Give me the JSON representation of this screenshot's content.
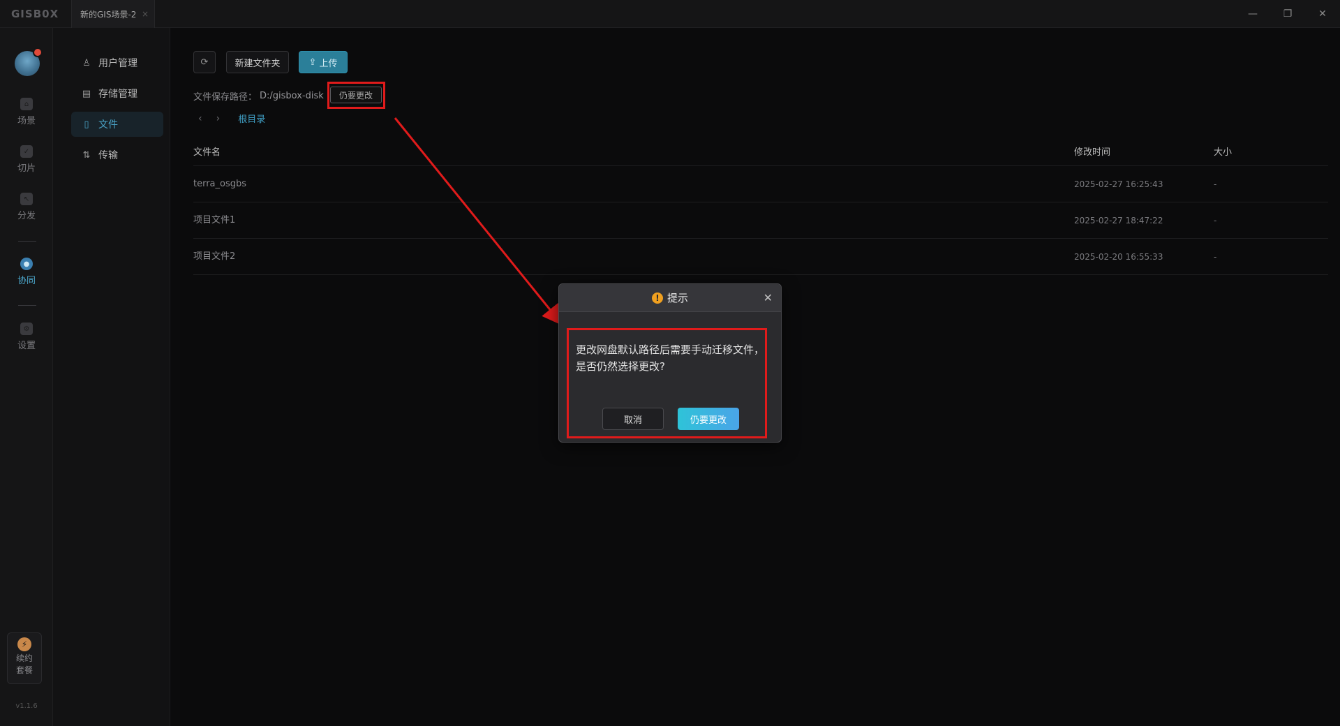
{
  "titlebar": {
    "logo": "GISB0X",
    "tab_label": "新的GIS场景-2",
    "tab_close": "×",
    "minimize": "—",
    "restore": "❐",
    "close": "✕"
  },
  "rail": {
    "items": [
      {
        "label": "场景",
        "icon": "scene-icon"
      },
      {
        "label": "切片",
        "icon": "tile-icon"
      },
      {
        "label": "分发",
        "icon": "distribute-icon"
      },
      {
        "label": "协同",
        "icon": "collab-icon",
        "active": true
      },
      {
        "label": "设置",
        "icon": "settings-icon"
      }
    ],
    "plan_line1": "续约",
    "plan_line2": "套餐",
    "version": "v1.1.6"
  },
  "submenu": {
    "items": [
      {
        "label": "用户管理",
        "icon": "user-icon"
      },
      {
        "label": "存储管理",
        "icon": "storage-icon"
      },
      {
        "label": "文件",
        "icon": "file-icon",
        "active": true
      },
      {
        "label": "传输",
        "icon": "transfer-icon"
      }
    ]
  },
  "toolbar": {
    "new_folder": "新建文件夹",
    "upload": "上传"
  },
  "path": {
    "label": "文件保存路径：",
    "value": "D:/gisbox-disk",
    "change_button": "仍要更改"
  },
  "breadcrumb": {
    "back": "‹",
    "forward": "›",
    "root": "根目录"
  },
  "table": {
    "headers": {
      "name": "文件名",
      "time": "修改时间",
      "size": "大小"
    },
    "rows": [
      {
        "name": "terra_osgbs",
        "time": "2025-02-27 16:25:43",
        "size": "-"
      },
      {
        "name": "项目文件1",
        "time": "2025-02-27 18:47:22",
        "size": "-"
      },
      {
        "name": "项目文件2",
        "time": "2025-02-20 16:55:33",
        "size": "-"
      }
    ]
  },
  "dialog": {
    "title": "提示",
    "warn_glyph": "!",
    "close": "✕",
    "message": "更改网盘默认路径后需要手动迁移文件，是否仍然选择更改?",
    "cancel": "取消",
    "confirm": "仍要更改"
  },
  "colors": {
    "accent": "#3f9ec4",
    "annotation": "#e01b1b",
    "warning": "#f0a020"
  }
}
